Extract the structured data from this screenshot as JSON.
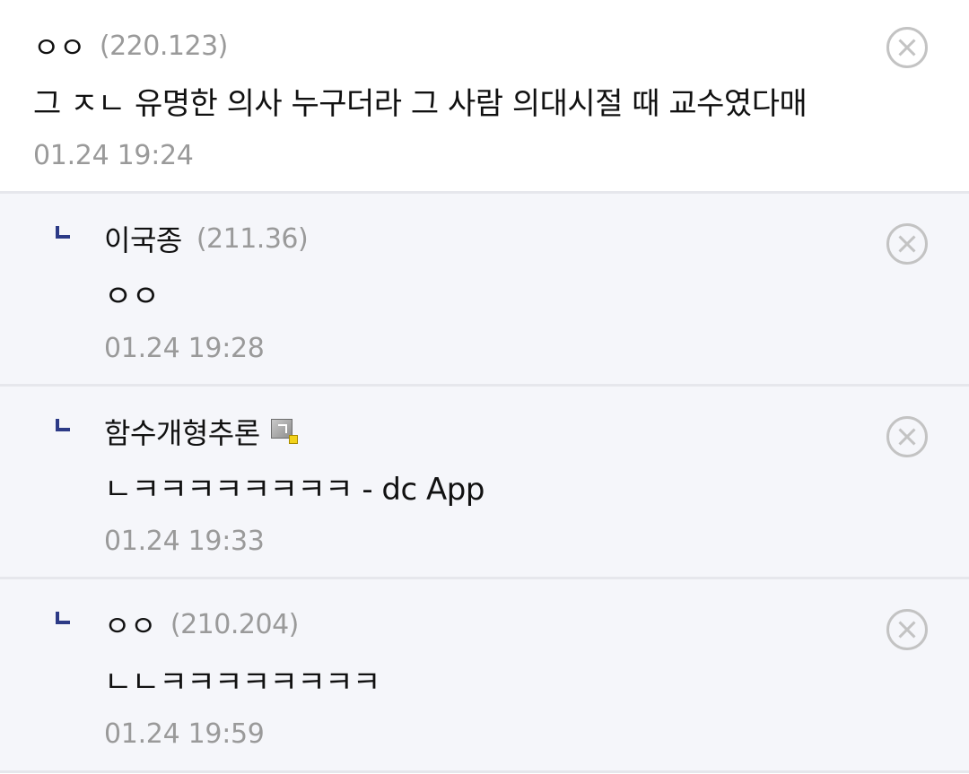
{
  "comments": [
    {
      "nickname": "ㅇㅇ",
      "ip": "(220.123)",
      "text": "그 ㅈㄴ 유명한 의사 누구더라 그 사람 의대시절 때 교수였다매",
      "timestamp": "01.24 19:24",
      "delete_icon": "close-circle-icon"
    },
    {
      "nickname": "이국종",
      "ip": "(211.36)",
      "text": "ㅇㅇ",
      "timestamp": "01.24 19:28",
      "reply_icon": "reply-arrow-icon",
      "delete_icon": "close-circle-icon"
    },
    {
      "nickname": "함수개형추론",
      "badge_icon": "fixed-nick-gallog-icon",
      "text": "ㄴㅋㅋㅋㅋㅋㅋㅋㅋ - dc App",
      "timestamp": "01.24 19:33",
      "reply_icon": "reply-arrow-icon",
      "delete_icon": "close-circle-icon"
    },
    {
      "nickname": "ㅇㅇ",
      "ip": "(210.204)",
      "text": "ㄴㄴㅋㅋㅋㅋㅋㅋㅋㅋ",
      "timestamp": "01.24 19:59",
      "reply_icon": "reply-arrow-icon",
      "delete_icon": "close-circle-icon"
    }
  ],
  "colors": {
    "reply_background": "#f5f6fa",
    "divider": "#e6e7ec",
    "reply_arrow": "#2c3a86",
    "meta_text": "#9a9a9a",
    "gallog_badge_dot": "#f2d21b"
  }
}
